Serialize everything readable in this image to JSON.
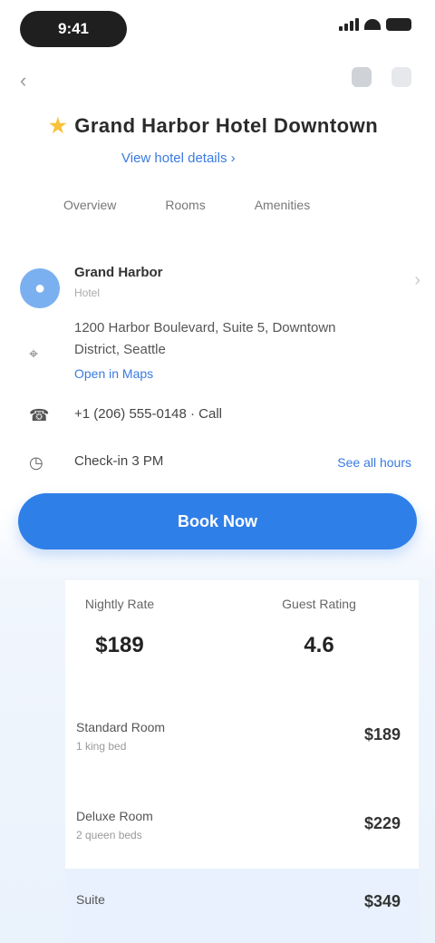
{
  "status_bar": {
    "time": "9:41"
  },
  "hotel": {
    "name": "Grand Harbor Hotel Downtown",
    "link": "View hotel details ›"
  },
  "tabs": [
    "Overview",
    "Rooms",
    "Amenities"
  ],
  "location": {
    "name": "Grand Harbor",
    "sub": "Hotel",
    "address": "1200 Harbor Boulevard, Suite 5, Downtown District, Seattle",
    "map_link": "Open in Maps",
    "phone": "+1 (206) 555-0148 · Call",
    "hours": "Check-in 3 PM",
    "hours_link": "See all hours"
  },
  "book_button": "Book Now",
  "stats": [
    {
      "label": "Nightly Rate",
      "value": "$189"
    },
    {
      "label": "Guest Rating",
      "value": "4.6"
    }
  ],
  "rows": [
    {
      "title": "Standard Room",
      "sub": "1 king bed",
      "value": "$189"
    },
    {
      "title": "Deluxe Room",
      "sub": "2 queen beds",
      "value": "$229"
    },
    {
      "title": "Suite",
      "sub": "",
      "value": "$349"
    }
  ]
}
